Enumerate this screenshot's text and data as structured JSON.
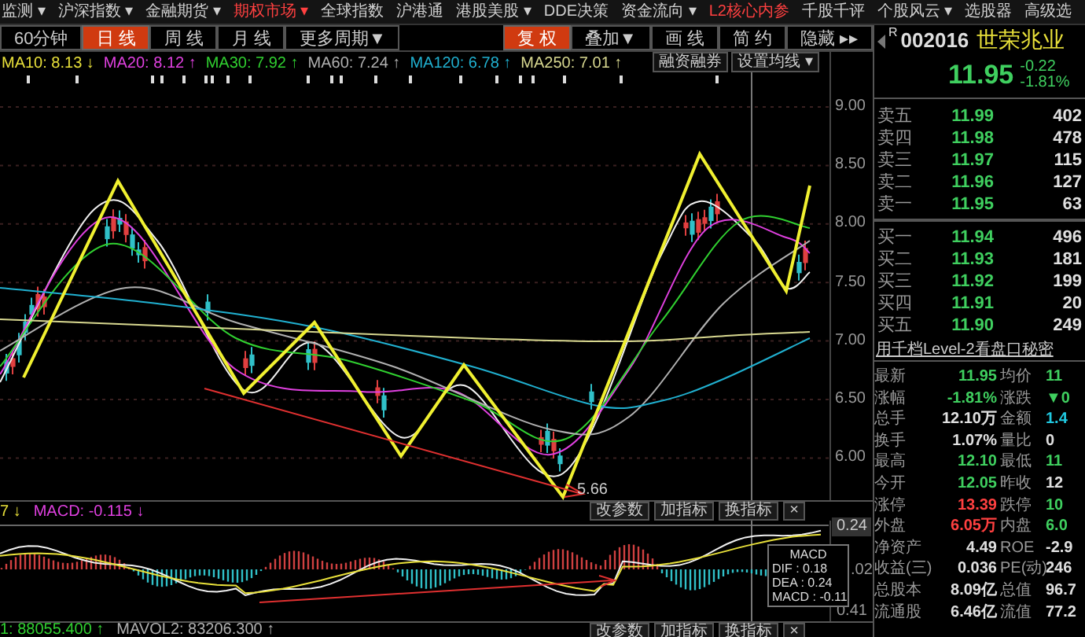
{
  "menu": [
    {
      "label": "监测 ▾",
      "selected": false
    },
    {
      "label": "沪深指数 ▾",
      "selected": false
    },
    {
      "label": "金融期货 ▾",
      "selected": false
    },
    {
      "label": "期权市场 ▾",
      "selected": true
    },
    {
      "label": "全球指数",
      "selected": false
    },
    {
      "label": "沪港通",
      "selected": false
    },
    {
      "label": "港股美股 ▾",
      "selected": false
    },
    {
      "label": "DDE决策",
      "selected": false
    },
    {
      "label": "资金流向 ▾",
      "selected": false
    },
    {
      "label": "L2核心内参",
      "selected": true
    },
    {
      "label": "千股千评",
      "selected": false
    },
    {
      "label": "个股风云 ▾",
      "selected": false
    },
    {
      "label": "选股器",
      "selected": false
    },
    {
      "label": "高级选",
      "selected": false
    }
  ],
  "periods": [
    {
      "label": "60分钟",
      "selected": false
    },
    {
      "label": "日 线",
      "selected": true
    },
    {
      "label": "周 线",
      "selected": false
    },
    {
      "label": "月 线",
      "selected": false
    },
    {
      "label": "更多周期▼",
      "selected": false
    }
  ],
  "chart_tools": [
    {
      "label": "复 权",
      "selected": true
    },
    {
      "label": "叠加▼",
      "selected": false
    },
    {
      "label": "画 线",
      "selected": false
    },
    {
      "label": "简 约",
      "selected": false
    },
    {
      "label": "隐藏 ▸▸",
      "selected": false
    }
  ],
  "moving_averages": [
    {
      "label": "MA10: 8.13",
      "arrow": "↓",
      "color": "#e8e03a"
    },
    {
      "label": "MA20: 8.12",
      "arrow": "↑",
      "color": "#e040e0"
    },
    {
      "label": "MA30: 7.92",
      "arrow": "↑",
      "color": "#30d030"
    },
    {
      "label": "MA60: 7.24",
      "arrow": "↑",
      "color": "#b0b0b0"
    },
    {
      "label": "MA120: 6.78",
      "arrow": "↑",
      "color": "#20b0d0"
    },
    {
      "label": "MA250: 7.01",
      "arrow": "↑",
      "color": "#d8d890"
    }
  ],
  "chart_buttons": [
    "融资融券",
    "设置均线 ▾"
  ],
  "price_axis": [
    "9.00",
    "8.50",
    "8.00",
    "7.50",
    "7.00",
    "6.50",
    "6.00"
  ],
  "low_label": "5.66",
  "indicator": {
    "header": [
      {
        "text": "7 ↓",
        "color": "#e8e03a"
      },
      {
        "text": "MACD: -0.115 ↓",
        "color": "#e040e0"
      }
    ],
    "buttons": [
      "改参数",
      "加指标",
      "换指标",
      "×"
    ],
    "axis": [
      "0.24",
      ".02",
      "0.41"
    ],
    "legend": {
      "title": "MACD",
      "lines": [
        "DIF : 0.18",
        "DEA : 0.24",
        "MACD : -0.11"
      ]
    }
  },
  "volume": {
    "header": [
      {
        "text": "1: 88055.400 ↑",
        "color": "#30d030"
      },
      {
        "text": "MAVOL2: 83206.300 ↑",
        "color": "#b0b0b0"
      }
    ],
    "buttons": [
      "改参数",
      "加指标",
      "换指标",
      "×"
    ]
  },
  "quote": {
    "prefix": "R",
    "code": "002016",
    "name": "世荣兆业",
    "price": "11.95",
    "change": "-0.22",
    "change_pct": "-1.81%"
  },
  "order_book": {
    "asks": [
      {
        "label": "卖五",
        "price": "11.99",
        "volume": "402"
      },
      {
        "label": "卖四",
        "price": "11.98",
        "volume": "478"
      },
      {
        "label": "卖三",
        "price": "11.97",
        "volume": "115"
      },
      {
        "label": "卖二",
        "price": "11.96",
        "volume": "127"
      },
      {
        "label": "卖一",
        "price": "11.95",
        "volume": "63"
      }
    ],
    "bids": [
      {
        "label": "买一",
        "price": "11.94",
        "volume": "496"
      },
      {
        "label": "买二",
        "price": "11.93",
        "volume": "181"
      },
      {
        "label": "买三",
        "price": "11.92",
        "volume": "199"
      },
      {
        "label": "买四",
        "price": "11.91",
        "volume": "20"
      },
      {
        "label": "买五",
        "price": "11.90",
        "volume": "249"
      }
    ]
  },
  "promo": "用千档Level-2看盘口秘密",
  "stats": [
    {
      "left": {
        "label": "最新",
        "value": "11.95",
        "color": "#3fcf5f"
      },
      "right": {
        "label": "均价",
        "value": "11",
        "color": "#3fcf5f"
      }
    },
    {
      "left": {
        "label": "涨幅",
        "value": "-1.81%",
        "color": "#3fcf5f"
      },
      "right": {
        "label": "涨跌",
        "value": "▼0",
        "color": "#3fcf5f"
      }
    },
    {
      "left": {
        "label": "总手",
        "value": "12.10万",
        "color": "#e0e0e0"
      },
      "right": {
        "label": "金额",
        "value": "1.4",
        "color": "#20c8e0"
      }
    },
    {
      "left": {
        "label": "换手",
        "value": "1.07%",
        "color": "#e0e0e0"
      },
      "right": {
        "label": "量比",
        "value": "0",
        "color": "#e0e0e0"
      }
    },
    {
      "left": {
        "label": "最高",
        "value": "12.10",
        "color": "#3fcf5f"
      },
      "right": {
        "label": "最低",
        "value": "11",
        "color": "#3fcf5f"
      }
    },
    {
      "left": {
        "label": "今开",
        "value": "12.05",
        "color": "#3fcf5f"
      },
      "right": {
        "label": "昨收",
        "value": "12",
        "color": "#e0e0e0"
      }
    },
    {
      "left": {
        "label": "涨停",
        "value": "13.39",
        "color": "#ff4040"
      },
      "right": {
        "label": "跌停",
        "value": "10",
        "color": "#3fcf5f"
      }
    },
    {
      "left": {
        "label": "外盘",
        "value": "6.05万",
        "color": "#ff4040"
      },
      "right": {
        "label": "内盘",
        "value": "6.0",
        "color": "#3fcf5f"
      }
    },
    {
      "left": {
        "label": "净资产",
        "value": "4.49",
        "color": "#e0e0e0"
      },
      "right": {
        "label": "ROE",
        "value": "-2.9",
        "color": "#e0e0e0"
      }
    },
    {
      "left": {
        "label": "收益(三)",
        "value": "0.036",
        "color": "#e0e0e0"
      },
      "right": {
        "label": "PE(动)",
        "value": "246",
        "color": "#e0e0e0"
      }
    },
    {
      "left": {
        "label": "总股本",
        "value": "8.09亿",
        "color": "#e0e0e0"
      },
      "right": {
        "label": "总值",
        "value": "96.7",
        "color": "#e0e0e0"
      }
    },
    {
      "left": {
        "label": "流通股",
        "value": "6.46亿",
        "color": "#e0e0e0"
      },
      "right": {
        "label": "流值",
        "value": "77.2",
        "color": "#e0e0e0"
      }
    }
  ]
}
